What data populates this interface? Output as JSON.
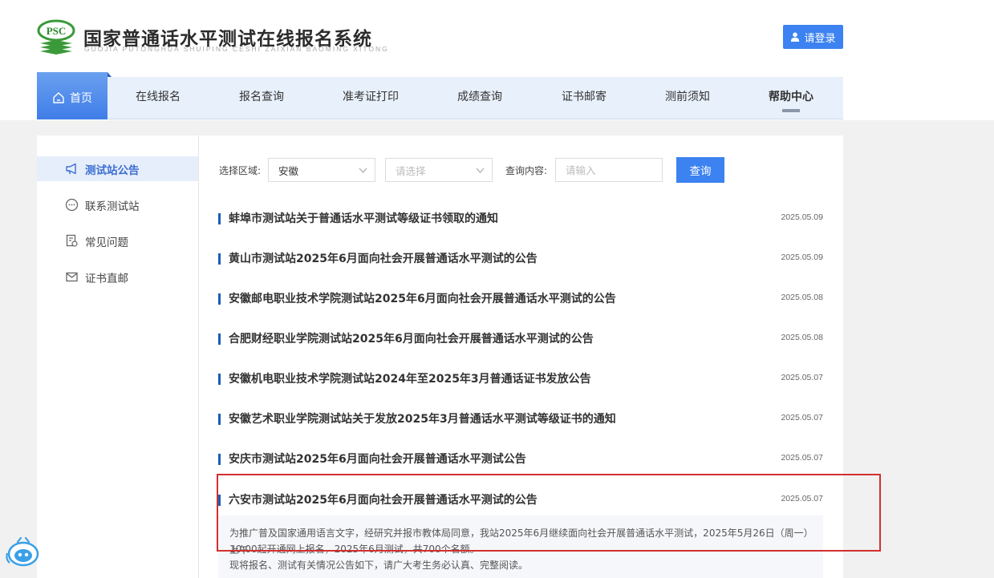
{
  "header": {
    "logo_text": "PSC",
    "title": "国家普通话水平测试在线报名系统",
    "subtitle": "GUOJIA PUTONGHUA SHUIPING CESHI ZAIXIAN BAOMING XITONG",
    "login_label": "请登录"
  },
  "nav": {
    "items": [
      "首页",
      "在线报名",
      "报名查询",
      "准考证打印",
      "成绩查询",
      "证书邮寄",
      "测前须知",
      "帮助中心"
    ]
  },
  "sidebar": {
    "items": [
      "测试站公告",
      "联系测试站",
      "常见问题",
      "证书直邮"
    ]
  },
  "filter": {
    "region_label": "选择区域:",
    "province": "安徽",
    "city_placeholder": "请选择",
    "query_label": "查询内容:",
    "query_placeholder": "请输入",
    "query_button": "查询"
  },
  "news": [
    {
      "title": "蚌埠市测试站关于普通话水平测试等级证书领取的通知",
      "date": "2025.05.09"
    },
    {
      "title": "黄山市测试站2025年6月面向社会开展普通话水平测试的公告",
      "date": "2025.05.09"
    },
    {
      "title": "安徽邮电职业技术学院测试站2025年6月面向社会开展普通话水平测试的公告",
      "date": "2025.05.08"
    },
    {
      "title": "合肥财经职业学院测试站2025年6月面向社会开展普通话水平测试的公告",
      "date": "2025.05.08"
    },
    {
      "title": "安徽机电职业技术学院测试站2024年至2025年3月普通话证书发放公告",
      "date": "2025.05.07"
    },
    {
      "title": "安徽艺术职业学院测试站关于发放2025年3月普通话水平测试等级证书的通知",
      "date": "2025.05.07"
    },
    {
      "title": "安庆市测试站2025年6月面向社会开展普通话水平测试公告",
      "date": "2025.05.07"
    },
    {
      "title": "六安市测试站2025年6月面向社会开展普通话水平测试的公告",
      "date": "2025.05.07"
    }
  ],
  "expanded": {
    "line1": "为推广普及国家通用语言文字，经研究并报市教体局同意，我站2025年6月继续面向社会开展普通话水平测试，2025年5月26日（周一）上午",
    "line2": "10:00起开通网上报名，2025年6月测试，共700个名额。",
    "line3": "现将报名、测试有关情况公告如下，请广大考生务必认真、完整阅读。"
  },
  "colors": {
    "brand_blue": "#3c82f0",
    "nav_bg": "#e8f0fb",
    "highlight_red": "#d32f2f"
  }
}
